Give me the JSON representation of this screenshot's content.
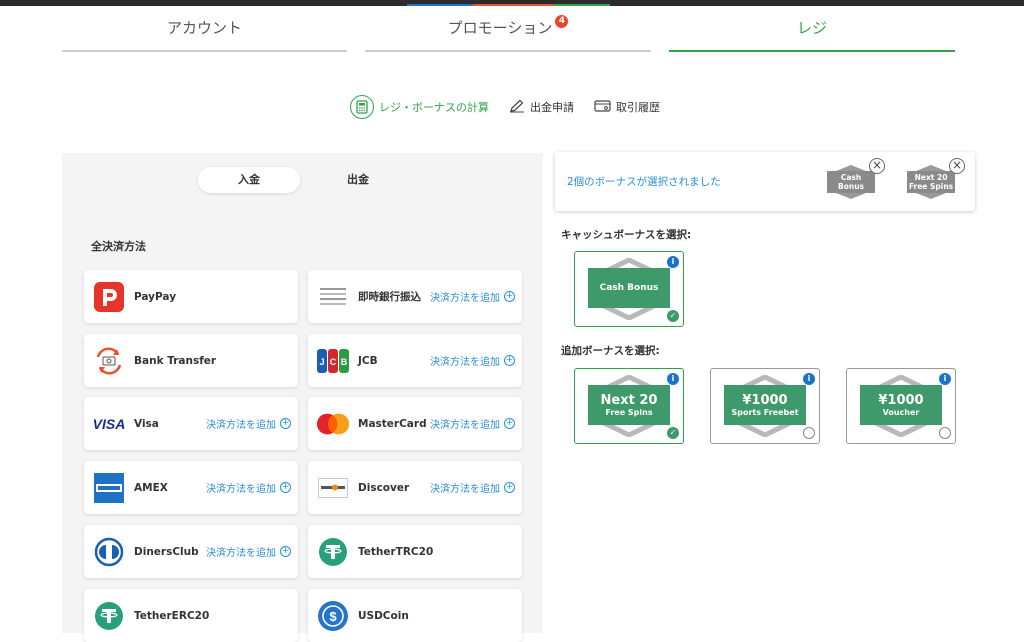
{
  "tabs": {
    "account": "アカウント",
    "promotion": "プロモーション",
    "promotion_badge": "4",
    "cashier": "レジ"
  },
  "subnav": {
    "calc": "レジ・ボーナスの計算",
    "withdraw": "出金申請",
    "history": "取引履歴"
  },
  "toggle": {
    "deposit": "入金",
    "withdraw": "出金"
  },
  "methods_title": "全決済方法",
  "add_label": "決済方法を追加",
  "methods": [
    {
      "name": "PayPay"
    },
    {
      "name": "即時銀行振込"
    },
    {
      "name": "Bank Transfer"
    },
    {
      "name": "JCB"
    },
    {
      "name": "Visa"
    },
    {
      "name": "MasterCard"
    },
    {
      "name": "AMEX"
    },
    {
      "name": "Discover"
    },
    {
      "name": "DinersClub"
    },
    {
      "name": "TetherTRC20"
    },
    {
      "name": "TetherERC20"
    },
    {
      "name": "USDCoin"
    }
  ],
  "selection": {
    "text": "2個のボーナスが選択されました",
    "chips": [
      {
        "line1": "Cash Bonus",
        "line2": ""
      },
      {
        "line1": "Next 20",
        "line2": "Free Spins"
      }
    ]
  },
  "cash_section_label": "キャッシュボーナスを選択:",
  "extra_section_label": "追加ボーナスを選択:",
  "cash_bonus": {
    "big": "Cash Bonus"
  },
  "extra_bonuses": [
    {
      "big": "Next 20",
      "small": "Free Spins"
    },
    {
      "big": "¥1000",
      "small": "Sports Freebet"
    },
    {
      "big": "¥1000",
      "small": "Voucher"
    }
  ],
  "info_glyph": "i",
  "close_glyph": "×",
  "colors": {
    "accent": "#2fa34b",
    "link": "#2a8fd6",
    "badge": "#e8452b",
    "bonus_plate": "#3e9a6a"
  }
}
